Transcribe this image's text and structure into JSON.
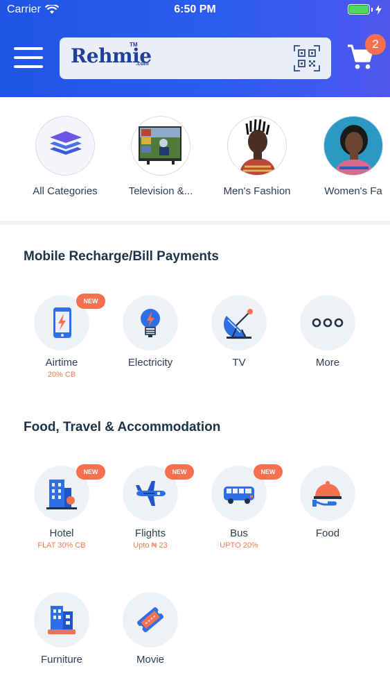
{
  "status_bar": {
    "carrier": "Carrier",
    "time": "6:50 PM"
  },
  "header": {
    "logo_text": "Rehmie",
    "logo_tm": "TM",
    "logo_domain": ".com",
    "cart_count": "2"
  },
  "categories": [
    {
      "label": "All Categories"
    },
    {
      "label": "Television &..."
    },
    {
      "label": "Men's Fashion"
    },
    {
      "label": "Women's Fa"
    }
  ],
  "recharge": {
    "title": "Mobile Recharge/Bill Payments",
    "items": [
      {
        "label": "Airtime",
        "sub": "20% CB",
        "badge": "NEW"
      },
      {
        "label": "Electricity"
      },
      {
        "label": "TV"
      },
      {
        "label": "More"
      }
    ]
  },
  "travel": {
    "title": "Food, Travel & Accommodation",
    "items": [
      {
        "label": "Hotel",
        "sub": "FLAT 30% CB",
        "badge": "NEW"
      },
      {
        "label": "Flights",
        "sub": "Upto ₦ 23",
        "badge": "NEW"
      },
      {
        "label": "Bus",
        "sub": "UPTO 20%",
        "badge": "NEW"
      },
      {
        "label": "Food"
      },
      {
        "label": "Furniture"
      },
      {
        "label": "Movie"
      }
    ]
  },
  "colors": {
    "brand_blue": "#2a5cf0",
    "accent_orange": "#f5704f",
    "battery_green": "#4cd964"
  }
}
